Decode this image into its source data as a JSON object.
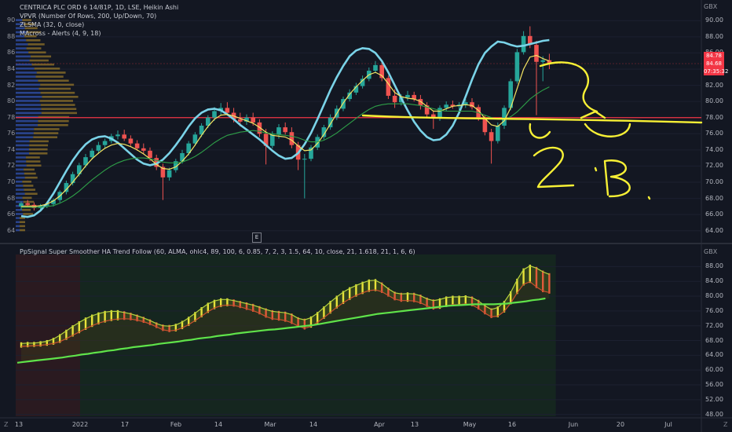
{
  "legend": {
    "symbol": "CENTRICA PLC ORD 6 14/81P, 1D, LSE, Heikin Ashi",
    "vpvr": "VPVR (Number Of Rows, 200, Up/Down, 70)",
    "zlsma": "ZLSMA (32, 0, close)",
    "macross": "MAcross - Alerts (4, 9, 18)"
  },
  "indicator_title": "PpSignal Super Smoother HA Trend Follow (60, ALMA, ohlc4, 89, 100, 6, 0.85, 7, 2, 3, 1.5, 64, 10, close, 21, 1.618, 21, 1, 6, 6)",
  "currency_label": "GBX",
  "currency_label_2": "GBX",
  "e_marker": "E",
  "corner_left": "Z",
  "corner_right": "Z",
  "price_tags": [
    {
      "value": "84.78",
      "color": "#f23645"
    },
    {
      "value": "84.68",
      "color": "#f23645"
    },
    {
      "value": "07:35:32",
      "color": "#f23645"
    }
  ],
  "colors": {
    "up": "#26a69a",
    "down": "#ef5350",
    "zlsma": "#7ad3e8",
    "fast_ma": "#f5e663",
    "slow_ma": "#2e9e48",
    "h_line": "#f23645",
    "drawing": "#f7f035",
    "vp_up": "#2f4fa8",
    "vp_down": "#9a7a2a"
  },
  "annotation_text": "",
  "chart_data": [
    {
      "type": "candlestick",
      "title": "CENTRICA PLC ORD 6 14/81P, 1D, LSE, Heikin Ashi",
      "xlabel": "",
      "ylabel": "GBX",
      "y_ticks": [
        "90.00",
        "88.00",
        "86.00",
        "84.00",
        "82.00",
        "80.00",
        "78.00",
        "76.00",
        "74.00",
        "72.00",
        "70.00",
        "68.00",
        "66.00",
        "64.00"
      ],
      "y_ticks_left": [
        "90",
        "88",
        "86",
        "84",
        "82",
        "80",
        "78",
        "76",
        "74",
        "72",
        "70",
        "68",
        "66",
        "64"
      ],
      "ylim": [
        63,
        91
      ],
      "x_ticks": [
        "13",
        "2022",
        "17",
        "Feb",
        "14",
        "Mar",
        "14",
        "Apr",
        "13",
        "May",
        "16",
        "Jun",
        "20",
        "Jul"
      ],
      "horizontal_line": 78.0,
      "last_price": 84.68,
      "candles": [
        [
          67.0,
          67.6,
          66.6,
          67.4
        ],
        [
          67.4,
          67.8,
          67.0,
          67.2
        ],
        [
          67.2,
          67.5,
          66.5,
          66.8
        ],
        [
          66.8,
          67.3,
          66.4,
          67.1
        ],
        [
          67.1,
          67.6,
          66.8,
          67.3
        ],
        [
          67.3,
          68.0,
          67.0,
          67.8
        ],
        [
          67.8,
          69.0,
          67.5,
          68.8
        ],
        [
          68.8,
          70.2,
          68.5,
          69.9
        ],
        [
          69.9,
          71.3,
          69.6,
          71.0
        ],
        [
          71.0,
          72.4,
          70.7,
          72.1
        ],
        [
          72.1,
          73.5,
          71.8,
          73.1
        ],
        [
          73.1,
          74.2,
          72.8,
          73.9
        ],
        [
          73.9,
          75.0,
          73.5,
          74.6
        ],
        [
          74.6,
          75.4,
          74.2,
          75.1
        ],
        [
          75.1,
          76.0,
          74.8,
          75.7
        ],
        [
          75.7,
          76.4,
          75.3,
          75.9
        ],
        [
          75.9,
          76.5,
          75.1,
          75.4
        ],
        [
          75.4,
          75.8,
          74.5,
          74.8
        ],
        [
          74.8,
          75.2,
          73.9,
          74.2
        ],
        [
          74.2,
          74.8,
          73.5,
          73.9
        ],
        [
          73.9,
          74.3,
          72.6,
          73.0
        ],
        [
          73.0,
          73.4,
          71.5,
          71.9
        ],
        [
          71.9,
          72.3,
          67.8,
          70.6
        ],
        [
          70.6,
          71.8,
          70.2,
          71.5
        ],
        [
          71.5,
          72.9,
          71.2,
          72.6
        ],
        [
          72.6,
          74.0,
          72.3,
          73.6
        ],
        [
          73.6,
          75.1,
          73.3,
          74.8
        ],
        [
          74.8,
          76.2,
          74.5,
          75.9
        ],
        [
          75.9,
          77.3,
          75.6,
          77.0
        ],
        [
          77.0,
          78.3,
          76.7,
          78.0
        ],
        [
          78.0,
          79.3,
          77.6,
          78.8
        ],
        [
          78.8,
          79.8,
          78.3,
          79.2
        ],
        [
          79.2,
          79.9,
          78.3,
          78.6
        ],
        [
          78.6,
          79.2,
          77.4,
          77.8
        ],
        [
          77.8,
          78.6,
          76.9,
          77.5
        ],
        [
          77.5,
          78.4,
          77.1,
          78.0
        ],
        [
          78.0,
          78.6,
          77.0,
          77.4
        ],
        [
          77.4,
          77.8,
          75.6,
          76.0
        ],
        [
          76.0,
          76.6,
          72.2,
          74.5
        ],
        [
          74.5,
          76.3,
          74.2,
          75.9
        ],
        [
          75.9,
          77.2,
          75.4,
          76.8
        ],
        [
          76.8,
          77.4,
          75.9,
          76.2
        ],
        [
          76.2,
          76.8,
          74.2,
          74.6
        ],
        [
          74.6,
          75.0,
          71.5,
          72.8
        ],
        [
          72.8,
          73.5,
          68.0,
          72.9
        ],
        [
          72.9,
          74.6,
          72.6,
          74.3
        ],
        [
          74.3,
          75.9,
          74.0,
          75.6
        ],
        [
          75.6,
          77.1,
          75.3,
          76.8
        ],
        [
          76.8,
          78.4,
          76.5,
          78.0
        ],
        [
          78.0,
          79.5,
          77.7,
          79.1
        ],
        [
          79.1,
          80.6,
          78.8,
          80.3
        ],
        [
          80.3,
          81.5,
          80.0,
          81.1
        ],
        [
          81.1,
          82.3,
          80.8,
          81.9
        ],
        [
          81.9,
          83.2,
          81.6,
          82.8
        ],
        [
          82.8,
          84.2,
          82.5,
          83.8
        ],
        [
          83.8,
          85.0,
          83.5,
          84.5
        ],
        [
          84.5,
          84.9,
          82.5,
          82.9
        ],
        [
          82.9,
          83.2,
          80.3,
          80.7
        ],
        [
          80.7,
          81.5,
          79.2,
          79.9
        ],
        [
          79.9,
          80.9,
          79.5,
          80.5
        ],
        [
          80.5,
          81.3,
          80.1,
          80.8
        ],
        [
          80.8,
          81.2,
          80.0,
          80.3
        ],
        [
          80.3,
          80.8,
          79.0,
          79.5
        ],
        [
          79.5,
          79.9,
          77.9,
          78.4
        ],
        [
          78.4,
          78.8,
          76.6,
          77.9
        ],
        [
          77.9,
          79.5,
          77.6,
          79.2
        ],
        [
          79.2,
          80.0,
          78.8,
          79.6
        ],
        [
          79.6,
          80.1,
          79.1,
          79.4
        ],
        [
          79.4,
          79.9,
          78.9,
          79.6
        ],
        [
          79.6,
          80.3,
          79.2,
          79.9
        ],
        [
          79.9,
          80.4,
          79.0,
          79.3
        ],
        [
          79.3,
          79.6,
          77.6,
          77.9
        ],
        [
          77.9,
          78.3,
          75.8,
          76.2
        ],
        [
          76.2,
          76.6,
          72.3,
          75.1
        ],
        [
          75.1,
          77.4,
          74.8,
          77.0
        ],
        [
          77.0,
          79.5,
          76.6,
          79.2
        ],
        [
          79.2,
          82.8,
          78.9,
          82.5
        ],
        [
          82.5,
          86.5,
          82.2,
          86.1
        ],
        [
          86.1,
          88.7,
          85.8,
          88.1
        ],
        [
          88.1,
          89.3,
          86.6,
          87.0
        ],
        [
          87.0,
          87.5,
          78.3,
          84.9
        ],
        [
          84.9,
          85.6,
          82.5,
          85.1
        ],
        [
          85.1,
          85.9,
          84.0,
          84.7
        ]
      ],
      "series": [
        {
          "name": "ZLSMA (32, 0, close)",
          "values": [
            65.8,
            65.7,
            65.9,
            66.5,
            67.4,
            68.6,
            70.0,
            71.4,
            72.7,
            73.8,
            74.7,
            75.3,
            75.6,
            75.7,
            75.4,
            74.9,
            74.2,
            73.5,
            72.8,
            72.3,
            72.1,
            72.3,
            72.8,
            73.6,
            74.6,
            75.7,
            76.9,
            77.9,
            78.6,
            79.0,
            79.1,
            78.9,
            78.4,
            77.8,
            77.1,
            76.5,
            75.9,
            75.3,
            74.6,
            73.9,
            73.3,
            72.9,
            73.0,
            73.6,
            74.7,
            76.1,
            77.8,
            79.6,
            81.4,
            83.0,
            84.4,
            85.6,
            86.3,
            86.6,
            86.5,
            86.0,
            85.0,
            83.6,
            82.0,
            80.4,
            78.9,
            77.5,
            76.4,
            75.6,
            75.2,
            75.3,
            75.9,
            77.0,
            78.6,
            80.6,
            82.7,
            84.6,
            86.0,
            86.8,
            87.4,
            87.3,
            87.0,
            86.8,
            86.9,
            87.1,
            87.3,
            87.5,
            87.6
          ]
        },
        {
          "name": "MAcross fast",
          "values": [
            67.0,
            67.0,
            67.0,
            67.1,
            67.3,
            67.7,
            68.3,
            69.1,
            70.0,
            71.0,
            72.0,
            72.9,
            73.6,
            74.2,
            74.6,
            74.8,
            74.7,
            74.4,
            74.0,
            73.5,
            72.9,
            72.2,
            71.7,
            71.6,
            71.9,
            72.6,
            73.5,
            74.6,
            75.8,
            76.9,
            77.8,
            78.3,
            78.4,
            78.2,
            77.9,
            77.6,
            77.3,
            76.8,
            76.2,
            75.8,
            75.7,
            75.6,
            75.2,
            74.5,
            73.9,
            74.0,
            74.8,
            75.9,
            77.2,
            78.5,
            79.8,
            80.9,
            81.8,
            82.6,
            83.3,
            83.6,
            83.2,
            82.2,
            81.1,
            80.6,
            80.4,
            80.3,
            80.0,
            79.4,
            78.8,
            78.8,
            79.1,
            79.4,
            79.5,
            79.6,
            79.5,
            78.9,
            77.9,
            77.1,
            76.9,
            77.6,
            79.2,
            81.6,
            84.0,
            85.5,
            85.7,
            85.3,
            85.0
          ]
        },
        {
          "name": "MAcross slow",
          "values": [
            66.9,
            66.9,
            66.9,
            66.9,
            67.0,
            67.1,
            67.4,
            67.8,
            68.3,
            68.9,
            69.6,
            70.3,
            70.9,
            71.5,
            72.0,
            72.4,
            72.7,
            72.9,
            73.0,
            73.0,
            72.9,
            72.7,
            72.5,
            72.4,
            72.4,
            72.5,
            72.8,
            73.2,
            73.7,
            74.3,
            74.9,
            75.4,
            75.8,
            76.0,
            76.2,
            76.3,
            76.4,
            76.3,
            76.1,
            76.0,
            75.9,
            75.8,
            75.7,
            75.5,
            75.2,
            75.0,
            75.0,
            75.2,
            75.6,
            76.1,
            76.7,
            77.3,
            77.9,
            78.5,
            79.0,
            79.4,
            79.6,
            79.7,
            79.7,
            79.7,
            79.7,
            79.6,
            79.5,
            79.3,
            79.1,
            78.9,
            78.8,
            78.8,
            78.8,
            78.8,
            78.8,
            78.6,
            78.3,
            78.0,
            77.8,
            77.8,
            78.1,
            78.7,
            79.5,
            80.3,
            80.9,
            81.4,
            81.8
          ]
        }
      ]
    },
    {
      "type": "line",
      "title": "PpSignal Super Smoother HA Trend Follow (60, ALMA, ohlc4, 89, 100, 6, 0.85, 7, 2, 3, 1.5, 64, 10, close, 21, 1.618, 21, 1, 6, 6)",
      "xlabel": "",
      "ylabel": "GBX",
      "y_ticks": [
        "88.00",
        "84.00",
        "80.00",
        "76.00",
        "72.00",
        "68.00",
        "64.00",
        "60.00",
        "56.00",
        "52.00",
        "48.00"
      ],
      "ylim": [
        47.5,
        90
      ],
      "series": [
        {
          "name": "trend",
          "values": [
            62.0,
            62.2,
            62.4,
            62.6,
            62.8,
            63.0,
            63.2,
            63.4,
            63.7,
            63.9,
            64.2,
            64.4,
            64.7,
            64.9,
            65.2,
            65.4,
            65.7,
            65.9,
            66.2,
            66.4,
            66.6,
            66.8,
            67.1,
            67.3,
            67.5,
            67.7,
            68.0,
            68.2,
            68.5,
            68.7,
            68.9,
            69.2,
            69.4,
            69.6,
            69.9,
            70.1,
            70.3,
            70.5,
            70.7,
            70.9,
            71.0,
            71.2,
            71.4,
            71.6,
            71.8,
            72.0,
            72.2,
            72.5,
            72.8,
            73.1,
            73.4,
            73.7,
            74.0,
            74.3,
            74.6,
            74.9,
            75.2,
            75.4,
            75.6,
            75.8,
            76.0,
            76.2,
            76.4,
            76.6,
            76.8,
            77.0,
            77.2,
            77.4,
            77.5,
            77.6,
            77.7,
            77.8,
            77.8,
            77.8,
            77.8,
            77.9,
            78.0,
            78.2,
            78.4,
            78.6,
            78.9,
            79.1,
            79.4
          ]
        },
        {
          "name": "upper",
          "values": [
            67.2,
            67.3,
            67.3,
            67.5,
            67.8,
            68.4,
            69.4,
            70.6,
            71.8,
            72.9,
            73.9,
            74.7,
            75.3,
            75.7,
            75.9,
            75.9,
            75.6,
            75.2,
            74.7,
            74.1,
            73.4,
            72.6,
            72.0,
            71.9,
            72.2,
            73.0,
            74.1,
            75.4,
            76.7,
            77.9,
            78.7,
            79.1,
            79.1,
            78.8,
            78.4,
            78.0,
            77.6,
            77.0,
            76.4,
            75.9,
            75.7,
            75.5,
            75.0,
            74.0,
            73.6,
            74.2,
            75.4,
            76.9,
            78.4,
            79.8,
            81.1,
            82.1,
            82.9,
            83.6,
            84.2,
            84.3,
            83.4,
            82.0,
            80.9,
            80.6,
            80.7,
            80.6,
            80.1,
            79.3,
            78.8,
            79.1,
            79.6,
            79.8,
            79.8,
            79.9,
            79.6,
            78.7,
            77.4,
            76.4,
            76.9,
            78.4,
            81.0,
            84.4,
            87.2,
            88.2,
            87.6,
            86.6,
            85.9
          ]
        },
        {
          "name": "lower",
          "values": [
            66.4,
            66.5,
            66.6,
            66.7,
            66.9,
            67.2,
            67.7,
            68.5,
            69.4,
            70.3,
            71.2,
            72.0,
            72.7,
            73.2,
            73.6,
            73.8,
            73.9,
            73.8,
            73.5,
            73.1,
            72.5,
            71.7,
            70.9,
            70.6,
            70.8,
            71.4,
            72.3,
            73.4,
            74.6,
            75.8,
            76.8,
            77.4,
            77.6,
            77.5,
            77.1,
            76.6,
            76.1,
            75.4,
            74.5,
            73.9,
            73.7,
            73.4,
            72.8,
            71.9,
            71.3,
            71.8,
            72.9,
            74.2,
            75.6,
            77.0,
            78.2,
            79.3,
            80.2,
            80.9,
            81.5,
            81.7,
            81.2,
            80.2,
            79.2,
            78.8,
            78.8,
            78.7,
            78.2,
            77.4,
            76.7,
            76.9,
            77.4,
            77.7,
            77.7,
            77.9,
            77.6,
            76.7,
            75.4,
            74.4,
            74.6,
            75.9,
            78.1,
            80.9,
            83.2,
            83.9,
            82.5,
            81.4,
            81.0
          ]
        }
      ]
    }
  ]
}
